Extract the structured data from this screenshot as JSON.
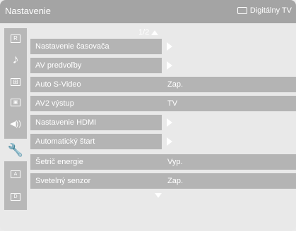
{
  "header": {
    "title": "Nastavenie",
    "source_label": "Digitálny TV"
  },
  "page_indicator": "1/2",
  "sidebar": {
    "items": [
      {
        "icon": "picture-icon",
        "glyph": ""
      },
      {
        "icon": "music-note-icon",
        "glyph": "♪"
      },
      {
        "icon": "grid-icon",
        "glyph": ""
      },
      {
        "icon": "features-icon",
        "glyph": ""
      },
      {
        "icon": "speaker-icon",
        "glyph": "◂)"
      },
      {
        "icon": "wrench-icon",
        "glyph": "🔧",
        "active": true
      },
      {
        "icon": "install-icon",
        "glyph": ""
      },
      {
        "icon": "source-icon",
        "glyph": ""
      }
    ]
  },
  "menu": {
    "items": [
      {
        "label": "Nastavenie časovača",
        "value": "",
        "submenu": true
      },
      {
        "label": "AV predvoľby",
        "value": "",
        "submenu": true
      },
      {
        "label": "Auto S-Video",
        "value": "Zap.",
        "submenu": false
      },
      {
        "label": "AV2 výstup",
        "value": "TV",
        "submenu": false
      },
      {
        "label": "Nastavenie HDMI",
        "value": "",
        "submenu": true
      },
      {
        "label": "Automatický štart",
        "value": "",
        "submenu": true
      },
      {
        "label": "Šetrič energie",
        "value": "Vyp.",
        "submenu": false
      },
      {
        "label": "Svetelný senzor",
        "value": "Zap.",
        "submenu": false
      }
    ]
  },
  "colors": {
    "titlebar": "#a4a4a4",
    "row": "#b4b4b4",
    "background": "#e9e9e9",
    "text": "#ffffff"
  }
}
